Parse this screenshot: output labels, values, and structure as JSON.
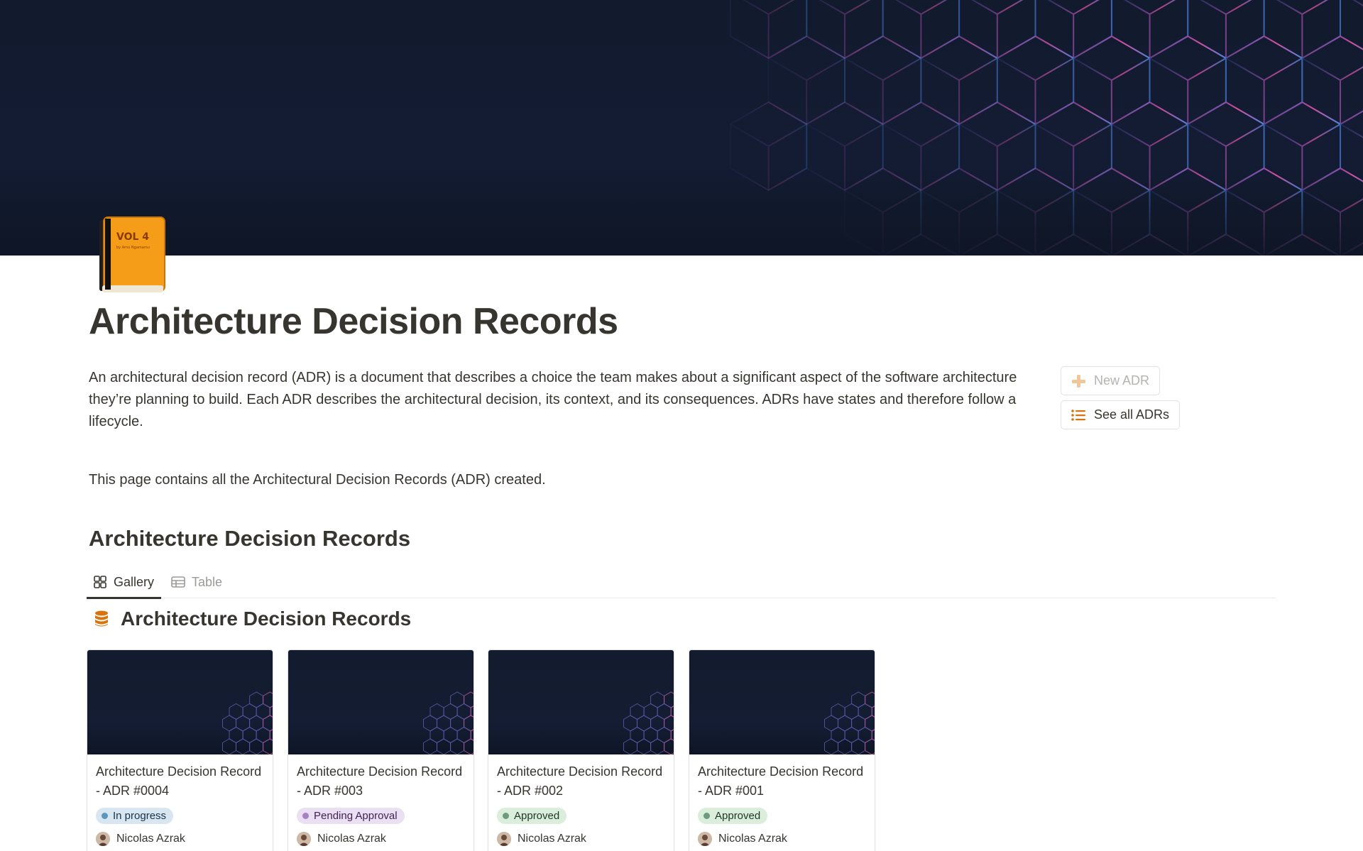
{
  "page": {
    "title": "Architecture Decision Records",
    "icon": "book-icon",
    "cover_colors": {
      "base": "#121a2d",
      "accent_pink": "#d74a9a",
      "accent_blue": "#4a7fd6"
    }
  },
  "description": {
    "paragraph": "An architectural decision record (ADR) is a document that describes a choice the team makes about a significant aspect of the software architecture they’re planning to build. Each ADR describes the architectural decision, its context, and its consequences. ADRs have states and therefore follow a lifecycle.",
    "note": "This page contains all the Architectural Decision Records (ADR) created."
  },
  "buttons": {
    "new_adr": {
      "label": "New ADR",
      "icon": "plus-icon"
    },
    "see_all": {
      "label": "See all ADRs",
      "icon": "list-icon"
    }
  },
  "section": {
    "heading": "Architecture Decision Records"
  },
  "tabs": [
    {
      "label": "Gallery",
      "icon": "gallery-icon",
      "active": true
    },
    {
      "label": "Table",
      "icon": "table-icon",
      "active": false
    }
  ],
  "database": {
    "title": "Architecture Decision Records",
    "icon": "database-icon"
  },
  "cards": [
    {
      "name": "Architecture Decision Record - ADR #0004",
      "status": "In progress",
      "author": "Nicolas Azrak"
    },
    {
      "name": "Architecture Decision Record - ADR #003",
      "status": "Pending Approval",
      "author": "Nicolas Azrak"
    },
    {
      "name": "Architecture Decision Record - ADR #002",
      "status": "Approved",
      "author": "Nicolas Azrak"
    },
    {
      "name": "Architecture Decision Record - ADR #001",
      "status": "Approved",
      "author": "Nicolas Azrak"
    }
  ],
  "status_colors": {
    "In progress": "#5b97bd",
    "Pending Approval": "#a782c3",
    "Approved": "#6c9b7d"
  }
}
